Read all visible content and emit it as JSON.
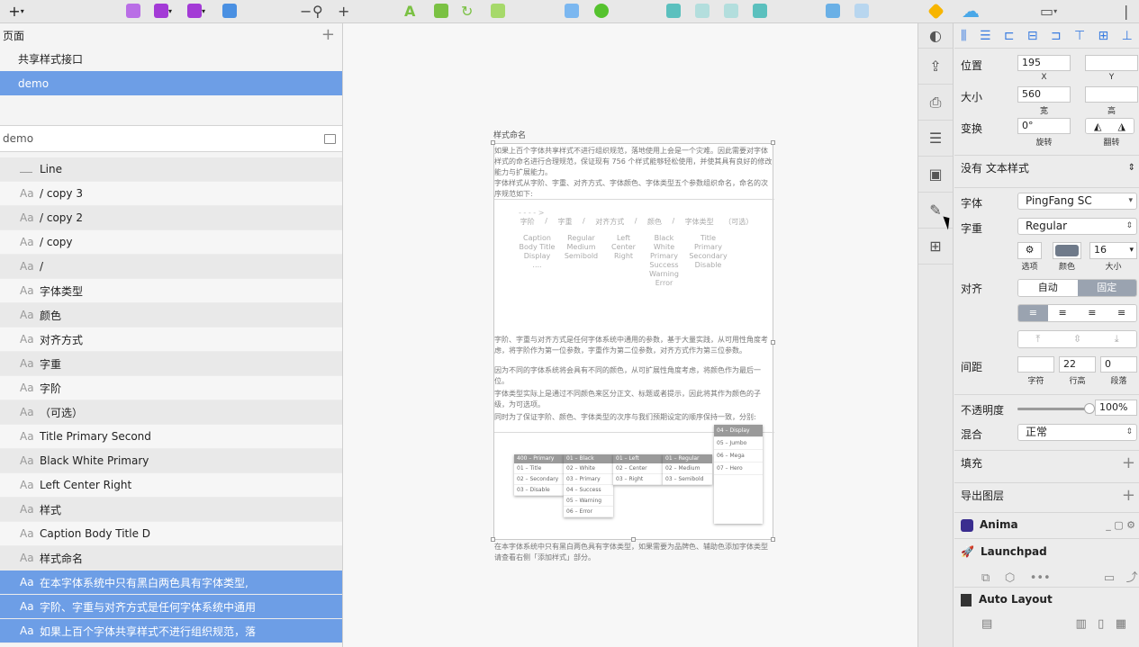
{
  "pages": {
    "header": "页面",
    "items": [
      {
        "label": "共享样式接口",
        "selected": false
      },
      {
        "label": "demo",
        "selected": true
      }
    ]
  },
  "layers": {
    "search_value": "demo",
    "items": [
      {
        "icon": "line",
        "label": "Line",
        "selected": false
      },
      {
        "icon": "Aa",
        "label": "/ copy 3",
        "selected": false
      },
      {
        "icon": "Aa",
        "label": "/ copy 2",
        "selected": false
      },
      {
        "icon": "Aa",
        "label": "/ copy",
        "selected": false
      },
      {
        "icon": "Aa",
        "label": "/",
        "selected": false
      },
      {
        "icon": "Aa",
        "label": "字体类型",
        "selected": false
      },
      {
        "icon": "Aa",
        "label": "颜色",
        "selected": false
      },
      {
        "icon": "Aa",
        "label": "对齐方式",
        "selected": false
      },
      {
        "icon": "Aa",
        "label": "字重",
        "selected": false
      },
      {
        "icon": "Aa",
        "label": "字阶",
        "selected": false
      },
      {
        "icon": "Aa",
        "label": "（可选）",
        "selected": false
      },
      {
        "icon": "Aa",
        "label": "Title Primary Second",
        "selected": false
      },
      {
        "icon": "Aa",
        "label": "Black White Primary",
        "selected": false
      },
      {
        "icon": "Aa",
        "label": "Left Center Right",
        "selected": false
      },
      {
        "icon": "Aa",
        "label": "样式",
        "selected": false
      },
      {
        "icon": "Aa",
        "label": "Caption Body Title D",
        "selected": false
      },
      {
        "icon": "Aa",
        "label": "样式命名",
        "selected": false
      },
      {
        "icon": "Aa",
        "label": "在本字体系统中只有黑白两色具有字体类型,",
        "selected": true
      },
      {
        "icon": "Aa",
        "label": "字阶、字重与对齐方式是任何字体系统中通用",
        "selected": true
      },
      {
        "icon": "Aa",
        "label": "如果上百个字体共享样式不进行组织规范，落",
        "selected": true
      }
    ]
  },
  "canvas": {
    "artboard_title": "样式命名",
    "para1": "如果上百个字体共享样式不进行组织规范，落地使用上会是一个灾难。因此需要对字体样式的命名进行合理规范，保证现有 756 个样式能够轻松使用，并使其具有良好的修改能力与扩展能力。",
    "para2": "字体样式从字阶、字重、对齐方式、字体颜色、字体类型五个参数组织命名，命名的次序规范如下:",
    "arrow": "- - - - >",
    "headers": [
      "字阶",
      "/",
      "字重",
      "/",
      "对齐方式",
      "/",
      "颜色",
      "/",
      "字体类型",
      "（可选）"
    ],
    "col1": "Caption Body Title Display ....",
    "col2": "Regular Medium Semibold",
    "col3": "Left Center Right",
    "col4": "Black White Primary Success Warning Error",
    "col5": "Title Primary Secondary Disable",
    "para3": "字阶、字重与对齐方式是任何字体系统中通用的参数，基于大量实践，从可用性角度考虑，将字阶作为第一位参数，字重作为第二位参数，对齐方式作为第三位参数。",
    "para4": "因为不同的字体系统将会具有不同的颜色，从可扩展性角度考虑，将颜色作为最后一位。",
    "para5": "字体类型实际上是通过不同颜色来区分正文、标题或者提示，因此将其作为颜色的子级，为可选项。",
    "para6": "同时为了保证字阶、颜色、字体类型的次序与我们预期设定的顺序保持一致，分别:",
    "para7": "在本字体系统中只有黑白两色具有字体类型，如果需要为品牌色、辅助色添加字体类型请查看右侧「添加样式」部分。",
    "mini_cols": [
      {
        "head": "400 – Primary",
        "rows": [
          "01 – Title",
          "02 – Secondary",
          "03 – Disable"
        ]
      },
      {
        "head": "01 – Black",
        "rows": [
          "02 – White",
          "03 – Primary",
          "04 – Success",
          "05 – Warning",
          "06 – Error"
        ]
      },
      {
        "head": "01 – Left",
        "rows": [
          "02 – Center",
          "03 – Right"
        ]
      },
      {
        "head": "01 – Regular",
        "rows": [
          "02 – Medium",
          "03 – Semibold"
        ]
      }
    ],
    "mini_panel": [
      "04 – Display",
      "05 – Jumbo",
      "06 – Mega",
      "07 – Hero"
    ]
  },
  "inspector": {
    "position_label": "位置",
    "x_value": "195",
    "x_caption": "X",
    "y_value": "",
    "y_caption": "Y",
    "size_label": "大小",
    "width_value": "560",
    "width_caption": "宽",
    "height_value": "",
    "height_caption": "高",
    "transform_label": "变换",
    "rotate_value": "0°",
    "rotate_caption": "旋转",
    "flip_caption": "翻转",
    "text_style": "没有 文本样式",
    "font_label": "字体",
    "font_value": "PingFang SC",
    "weight_label": "字重",
    "weight_value": "Regular",
    "options_caption": "选项",
    "color_caption": "颜色",
    "size_caption": "大小",
    "font_size": "16",
    "align_label": "对齐",
    "auto_label": "自动",
    "fixed_label": "固定",
    "spacing_label": "间距",
    "char_value": "",
    "char_caption": "字符",
    "line_value": "22",
    "line_caption": "行高",
    "para_value": "0",
    "para_caption": "段落",
    "opacity_label": "不透明度",
    "opacity_value": "100%",
    "opacity_fraction": 1.0,
    "blend_label": "混合",
    "blend_value": "正常",
    "fill_label": "填充",
    "export_label": "导出图层",
    "anima_label": "Anima",
    "launchpad_label": "Launchpad",
    "autolayout_label": "Auto Layout",
    "text_color": "#6f7a8a"
  }
}
